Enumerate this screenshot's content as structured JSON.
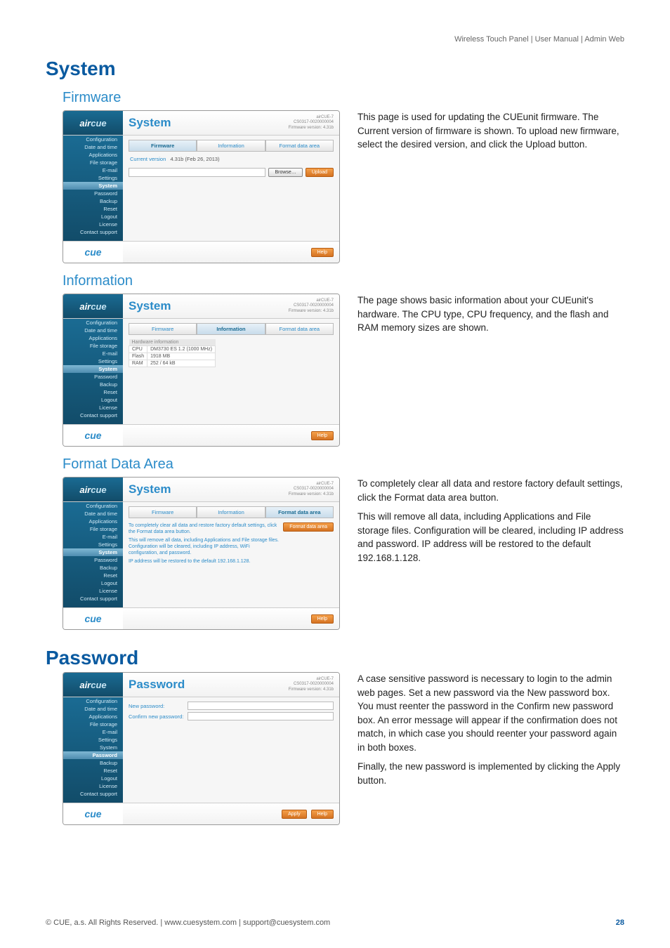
{
  "header": "Wireless Touch Panel  |  User Manual  |  Admin Web",
  "h1_system": "System",
  "h1_password": "Password",
  "sub_firmware": "Firmware",
  "sub_information": "Information",
  "sub_format": "Format Data Area",
  "firmware_desc": "This page is used for updating the CUEunit firmware. The Current version of firmware is shown. To upload new firmware, select the desired version, and click the Upload button.",
  "information_desc": "The page shows basic information about your CUEunit's hardware. The CPU type, CPU frequency, and the flash and RAM memory sizes are shown.",
  "format_desc1": "To completely clear all data and restore factory default settings, click the Format data area button.",
  "format_desc2": "This will remove all data, including Applications and File storage files. Configuration will be cleared, including IP address and password. IP address will be restored to the default 192.168.1.128.",
  "password_desc1": "A case sensitive password is necessary to login to the admin web pages. Set a new password via the New password box. You must reenter the password in the Confirm new password box. An error message will appear if the confirmation does not match, in which case you should reenter your password again in both boxes.",
  "password_desc2": "Finally, the new password is implemented by clicking the Apply button.",
  "footer_left": "© CUE, a.s. All Rights Reserved.  |  www.cuesystem.com  |  support@cuesystem.com",
  "footer_right": "28",
  "shot": {
    "logo1": "air",
    "logo2": "cue",
    "footlogo": "cue",
    "title_system": "System",
    "title_password": "Password",
    "meta1": "airCUE-7",
    "meta2": "CS0317-0020000004",
    "meta3": "Firmware version: 4.31b",
    "nav": [
      "Configuration",
      "Date and time",
      "Applications",
      "File storage",
      "E-mail",
      "Settings",
      "System",
      "Password",
      "Backup",
      "Reset",
      "Logout",
      "License",
      "Contact support"
    ],
    "tab_firmware": "Firmware",
    "tab_information": "Information",
    "tab_format": "Format data area",
    "curver_label": "Current version",
    "curver_value": "4.31b (Feb 26, 2013)",
    "browse": "Browse…",
    "upload": "Upload",
    "help": "Help",
    "apply": "Apply",
    "hwinfo_title": "Hardware information",
    "cpu_l": "CPU",
    "cpu_v": "DM3730 ES 1.2 (1000 MHz)",
    "flash_l": "Flash",
    "flash_v": "1918 MB",
    "ram_l": "RAM",
    "ram_v": "252 / 64 kB",
    "fmt_p1": "To completely clear all data and restore factory default settings, click the Format data area button.",
    "fmt_p2": "This will remove all data, including Applications and File storage files. Configuration will be cleared, including IP address, WiFi configuration, and password.",
    "fmt_p3": "IP address will be restored to the default 192.168.1.128.",
    "fmt_btn": "Format data area",
    "newpw": "New password:",
    "confirmpw": "Confirm new password:"
  }
}
